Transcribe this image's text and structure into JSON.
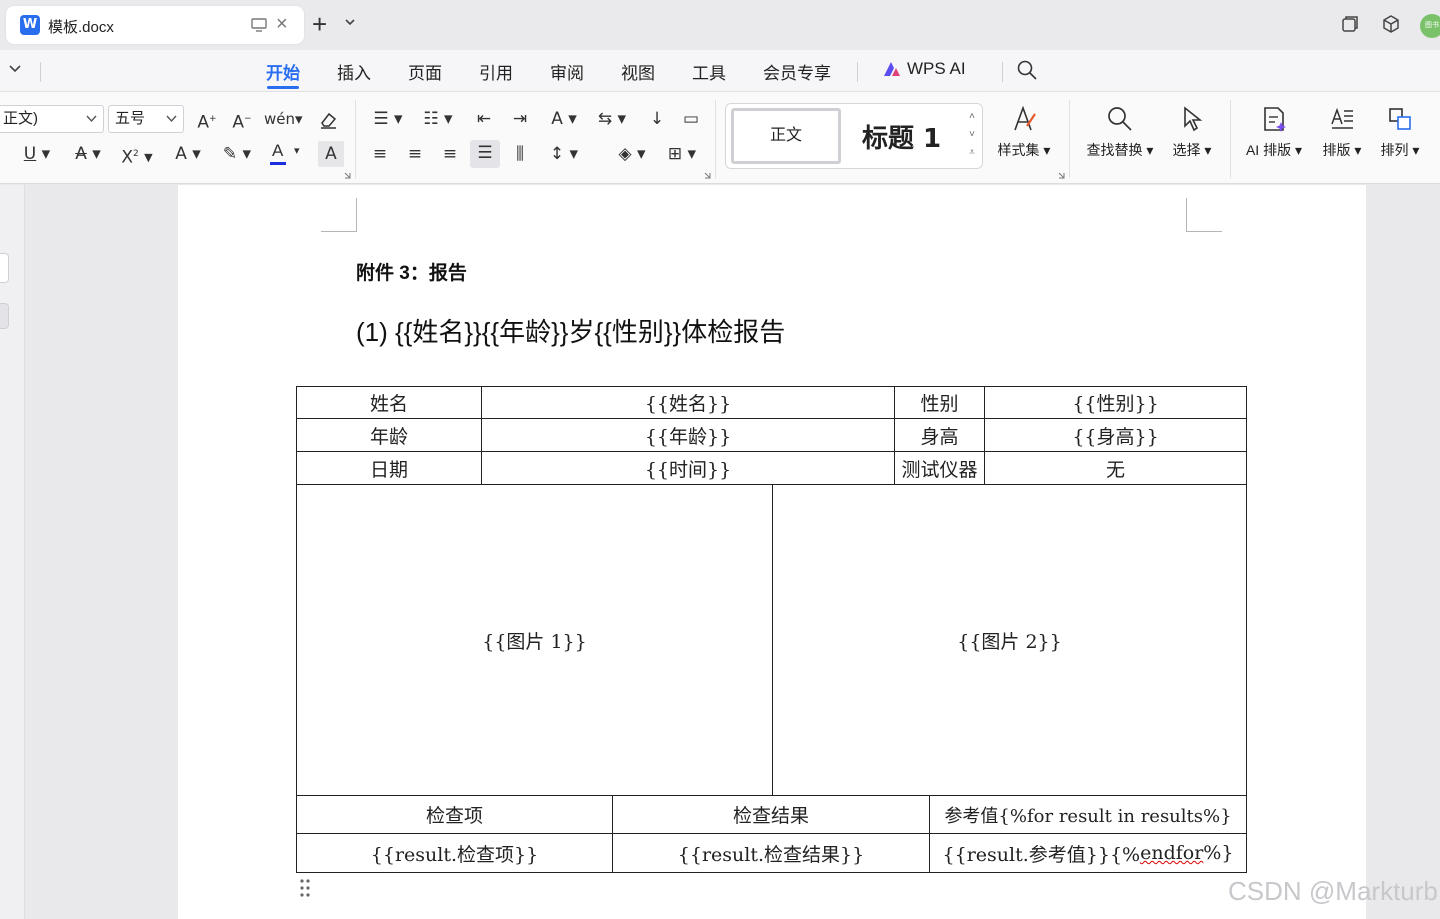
{
  "window": {
    "tab_title": "模板.docx",
    "avatar_text": "图书"
  },
  "menu": {
    "items": [
      "开始",
      "插入",
      "页面",
      "引用",
      "审阅",
      "视图",
      "工具",
      "会员专享"
    ],
    "ai_label": "WPS AI"
  },
  "ribbon": {
    "font_family": "正文)",
    "font_size": "五号",
    "style_normal": "正文",
    "style_heading": "标题 1",
    "style_set_label": "样式集",
    "find_replace_label": "查找替换",
    "select_label": "选择",
    "ai_layout_label": "AI 排版",
    "layout_label": "排版",
    "arrange_label": "排列",
    "icon_names": [
      "font-grow-icon",
      "font-shrink-icon",
      "phonetic-icon",
      "clear-format-icon",
      "underline-icon",
      "strikethrough-icon",
      "superscript-icon",
      "text-effect-icon",
      "highlight-icon",
      "font-color-icon",
      "char-shading-icon",
      "bullet-list-icon",
      "numbered-list-icon",
      "decrease-indent-icon",
      "increase-indent-icon",
      "text-direction-icon",
      "sort-icon",
      "show-marks-icon",
      "align-left-icon",
      "align-center-icon",
      "align-right-icon",
      "justify-icon",
      "distributed-icon",
      "line-spacing-icon",
      "shading-icon",
      "border-icon"
    ]
  },
  "document": {
    "attachment_title": "附件 3：报告",
    "report_title": "(1) {{姓名}}{{年龄}}岁{{性别}}体检报告",
    "info_table": [
      [
        "姓名",
        "{{姓名}}",
        "性别",
        "{{性别}}"
      ],
      [
        "年龄",
        "{{年龄}}",
        "身高",
        "{{身高}}"
      ],
      [
        "日期",
        "{{时间}}",
        "测试仪器",
        "无"
      ]
    ],
    "images": [
      "{{图片 1}}",
      "{{图片 2}}"
    ],
    "result_header": [
      "检查项",
      "检查结果",
      "参考值{%for result in results%}"
    ],
    "result_row": [
      "{{result.检查项}}",
      "{{result.检查结果}}",
      "{{result.参考值}}{%endfor%}"
    ],
    "result_row_endfor_prefix": "{{result.参考值}}{%",
    "result_row_endfor_word": "endfor",
    "result_row_endfor_suffix": "%}"
  },
  "watermark": "CSDN @Markturb",
  "colors": {
    "accent": "#2a6ef0",
    "font_color_bar": "#1a2ee0"
  }
}
